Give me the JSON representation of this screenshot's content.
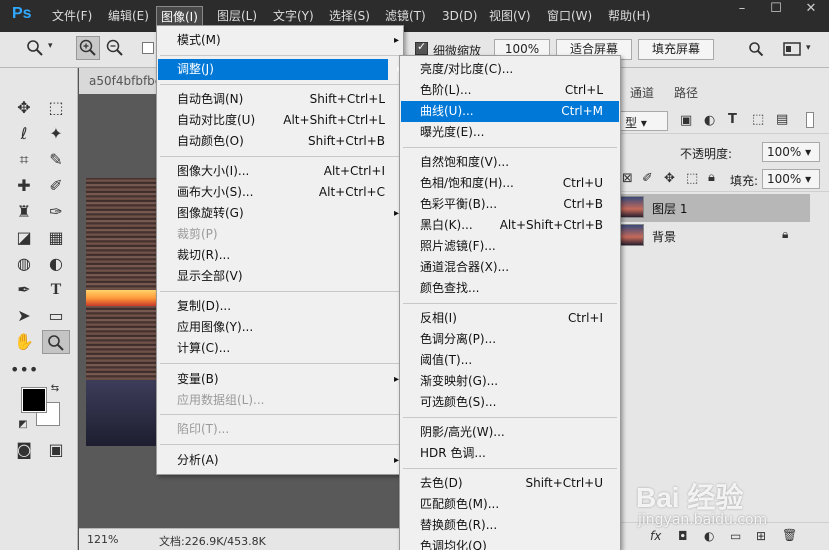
{
  "app": {
    "logo": "Ps"
  },
  "menubar": {
    "items": [
      "文件(F)",
      "编辑(E)",
      "图像(I)",
      "图层(L)",
      "文字(Y)",
      "选择(S)",
      "滤镜(T)",
      "3D(D)",
      "视图(V)",
      "窗口(W)",
      "帮助(H)"
    ],
    "active_index": 2
  },
  "window_controls": {
    "minimize": "–",
    "maximize": "☐",
    "close": "✕"
  },
  "options_bar": {
    "scrubby_zoom_label": "细微缩放",
    "zoom_value": "100%",
    "fit_screen": "适合屏幕",
    "fill_screen": "填充屏幕"
  },
  "document": {
    "tab_title": "a50f4bfbfbe",
    "zoom": "121%",
    "doc_info": "文档:226.9K/453.8K"
  },
  "right_panel": {
    "tabs": [
      "通道",
      "路径"
    ],
    "kind_label": "型",
    "opacity_label": "不透明度:",
    "opacity_value": "100%",
    "fill_label": "填充:",
    "fill_value": "100%",
    "layers": [
      {
        "name": "图层 1",
        "selected": true,
        "locked": false
      },
      {
        "name": "背景",
        "selected": false,
        "locked": true
      }
    ]
  },
  "image_menu": {
    "items": [
      {
        "label": "模式(M)",
        "shortcut": "",
        "submenu": true,
        "disabled": false,
        "highlighted": false
      },
      {
        "label": "调整(J)",
        "shortcut": "",
        "submenu": true,
        "disabled": false,
        "highlighted": true
      },
      {
        "label": "自动色调(N)",
        "shortcut": "Shift+Ctrl+L",
        "submenu": false,
        "disabled": false,
        "highlighted": false
      },
      {
        "label": "自动对比度(U)",
        "shortcut": "Alt+Shift+Ctrl+L",
        "submenu": false,
        "disabled": false,
        "highlighted": false
      },
      {
        "label": "自动颜色(O)",
        "shortcut": "Shift+Ctrl+B",
        "submenu": false,
        "disabled": false,
        "highlighted": false
      },
      {
        "label": "图像大小(I)...",
        "shortcut": "Alt+Ctrl+I",
        "submenu": false,
        "disabled": false,
        "highlighted": false
      },
      {
        "label": "画布大小(S)...",
        "shortcut": "Alt+Ctrl+C",
        "submenu": false,
        "disabled": false,
        "highlighted": false
      },
      {
        "label": "图像旋转(G)",
        "shortcut": "",
        "submenu": true,
        "disabled": false,
        "highlighted": false
      },
      {
        "label": "裁剪(P)",
        "shortcut": "",
        "submenu": false,
        "disabled": true,
        "highlighted": false
      },
      {
        "label": "裁切(R)...",
        "shortcut": "",
        "submenu": false,
        "disabled": false,
        "highlighted": false
      },
      {
        "label": "显示全部(V)",
        "shortcut": "",
        "submenu": false,
        "disabled": false,
        "highlighted": false
      },
      {
        "label": "复制(D)...",
        "shortcut": "",
        "submenu": false,
        "disabled": false,
        "highlighted": false
      },
      {
        "label": "应用图像(Y)...",
        "shortcut": "",
        "submenu": false,
        "disabled": false,
        "highlighted": false
      },
      {
        "label": "计算(C)...",
        "shortcut": "",
        "submenu": false,
        "disabled": false,
        "highlighted": false
      },
      {
        "label": "变量(B)",
        "shortcut": "",
        "submenu": true,
        "disabled": false,
        "highlighted": false
      },
      {
        "label": "应用数据组(L)...",
        "shortcut": "",
        "submenu": false,
        "disabled": true,
        "highlighted": false
      },
      {
        "label": "陷印(T)...",
        "shortcut": "",
        "submenu": false,
        "disabled": true,
        "highlighted": false
      },
      {
        "label": "分析(A)",
        "shortcut": "",
        "submenu": true,
        "disabled": false,
        "highlighted": false
      }
    ]
  },
  "adjust_menu": {
    "items": [
      {
        "label": "亮度/对比度(C)...",
        "shortcut": "",
        "highlighted": false
      },
      {
        "label": "色阶(L)...",
        "shortcut": "Ctrl+L",
        "highlighted": false
      },
      {
        "label": "曲线(U)...",
        "shortcut": "Ctrl+M",
        "highlighted": true
      },
      {
        "label": "曝光度(E)...",
        "shortcut": "",
        "highlighted": false
      },
      {
        "label": "自然饱和度(V)...",
        "shortcut": "",
        "highlighted": false
      },
      {
        "label": "色相/饱和度(H)...",
        "shortcut": "Ctrl+U",
        "highlighted": false
      },
      {
        "label": "色彩平衡(B)...",
        "shortcut": "Ctrl+B",
        "highlighted": false
      },
      {
        "label": "黑白(K)...",
        "shortcut": "Alt+Shift+Ctrl+B",
        "highlighted": false
      },
      {
        "label": "照片滤镜(F)...",
        "shortcut": "",
        "highlighted": false
      },
      {
        "label": "通道混合器(X)...",
        "shortcut": "",
        "highlighted": false
      },
      {
        "label": "颜色查找...",
        "shortcut": "",
        "highlighted": false
      },
      {
        "label": "反相(I)",
        "shortcut": "Ctrl+I",
        "highlighted": false
      },
      {
        "label": "色调分离(P)...",
        "shortcut": "",
        "highlighted": false
      },
      {
        "label": "阈值(T)...",
        "shortcut": "",
        "highlighted": false
      },
      {
        "label": "渐变映射(G)...",
        "shortcut": "",
        "highlighted": false
      },
      {
        "label": "可选颜色(S)...",
        "shortcut": "",
        "highlighted": false
      },
      {
        "label": "阴影/高光(W)...",
        "shortcut": "",
        "highlighted": false
      },
      {
        "label": "HDR 色调...",
        "shortcut": "",
        "highlighted": false
      },
      {
        "label": "去色(D)",
        "shortcut": "Shift+Ctrl+U",
        "highlighted": false
      },
      {
        "label": "匹配颜色(M)...",
        "shortcut": "",
        "highlighted": false
      },
      {
        "label": "替换颜色(R)...",
        "shortcut": "",
        "highlighted": false
      },
      {
        "label": "色调均化(Q)",
        "shortcut": "",
        "highlighted": false
      }
    ]
  },
  "watermark": {
    "logo": "Bai 经验",
    "url": "jingyan.baidu.com"
  }
}
